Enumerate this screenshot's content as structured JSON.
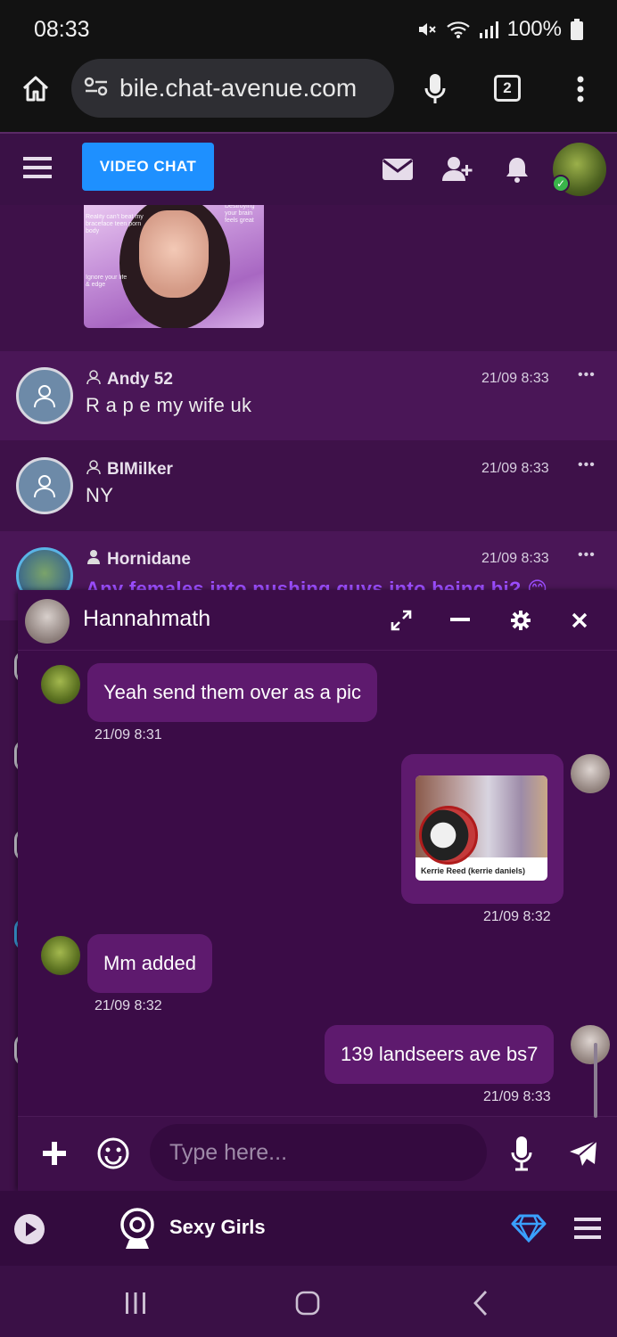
{
  "status_bar": {
    "time": "08:33",
    "battery": "100%"
  },
  "browser": {
    "url": "bile.chat-avenue.com",
    "tab_count": "2"
  },
  "site_header": {
    "video_chat_label": "VIDEO CHAT"
  },
  "feed": {
    "image_captions": [
      "Reality can't beat my braceface teen porn body",
      "Destroying your brain feels great",
      "Ignore your life & edge"
    ],
    "messages": [
      {
        "user": "Andy 52",
        "text": "R a p e my wife uk",
        "time": "21/09 8:33"
      },
      {
        "user": "BIMilker",
        "text": "NY",
        "time": "21/09 8:33"
      },
      {
        "user": "Hornidane",
        "text": "Any females into pushing guys into being bi? 😊",
        "time": "21/09 8:33"
      }
    ]
  },
  "private_chat": {
    "contact_name": "Hannahmath",
    "messages": [
      {
        "direction": "in",
        "text": "Yeah send them over as a pic",
        "time": "21/09 8:31"
      },
      {
        "direction": "out",
        "type": "image",
        "caption": "Kerrie Reed (kerrie daniels)",
        "time": "21/09 8:32"
      },
      {
        "direction": "in",
        "text": "Mm added",
        "time": "21/09 8:32"
      },
      {
        "direction": "out",
        "text": "139 landseers ave bs7",
        "time": "21/09 8:33"
      }
    ],
    "input_placeholder": "Type here..."
  },
  "bottom_bar": {
    "room_label": "Sexy Girls"
  },
  "colors": {
    "accent_blue": "#1e90ff",
    "panel_purple": "#3b0c47",
    "bubble_purple": "#5e1a6e",
    "online_green": "#39b54a"
  }
}
